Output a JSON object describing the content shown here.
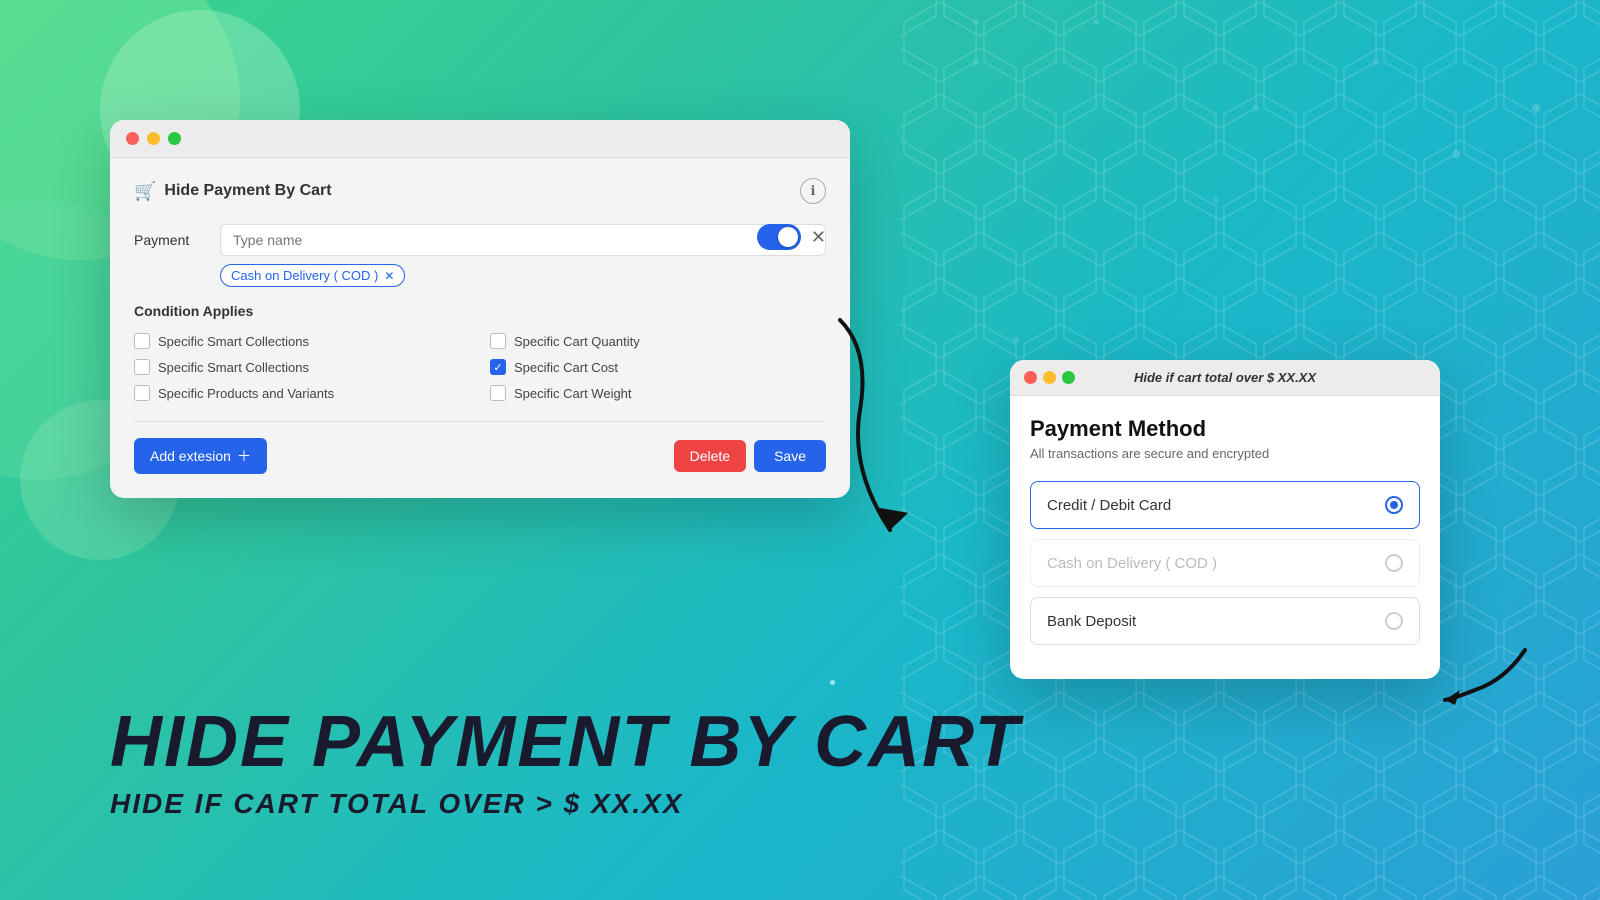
{
  "background": {
    "gradient_start": "#3dd68c",
    "gradient_end": "#2a9fd6"
  },
  "bottom_text": {
    "main_title": "HIDE PAYMENT BY CART",
    "sub_title": "HIDE IF CART TOTAL OVER > $ XX.XX"
  },
  "app_window": {
    "title": "Hide Payment By Cart",
    "payment_label": "Payment",
    "payment_placeholder": "Type name",
    "tag_text": "Cash on Delivery ( COD )",
    "condition_title": "Condition Applies",
    "conditions": [
      {
        "label": "Specific Smart Collections",
        "checked": false,
        "col": 1
      },
      {
        "label": "Specific Cart Quantity",
        "checked": false,
        "col": 2
      },
      {
        "label": "Specific Smart Collections",
        "checked": false,
        "col": 1
      },
      {
        "label": "Specific Cart Cost",
        "checked": true,
        "col": 2
      },
      {
        "label": "Specific Products and Variants",
        "checked": false,
        "col": 1
      },
      {
        "label": "Specific Cart Weight",
        "checked": false,
        "col": 2
      }
    ],
    "btn_add": "Add extesion",
    "btn_delete": "Delete",
    "btn_save": "Save"
  },
  "payment_window": {
    "titlebar_text": "Hide if cart total over $ XX.XX",
    "title": "Payment Method",
    "subtitle": "All transactions are secure and encrypted",
    "options": [
      {
        "label": "Credit / Debit Card",
        "selected": true,
        "dimmed": false
      },
      {
        "label": "Cash on Delivery ( COD )",
        "selected": false,
        "dimmed": true
      },
      {
        "label": "Bank Deposit",
        "selected": false,
        "dimmed": false
      }
    ]
  }
}
